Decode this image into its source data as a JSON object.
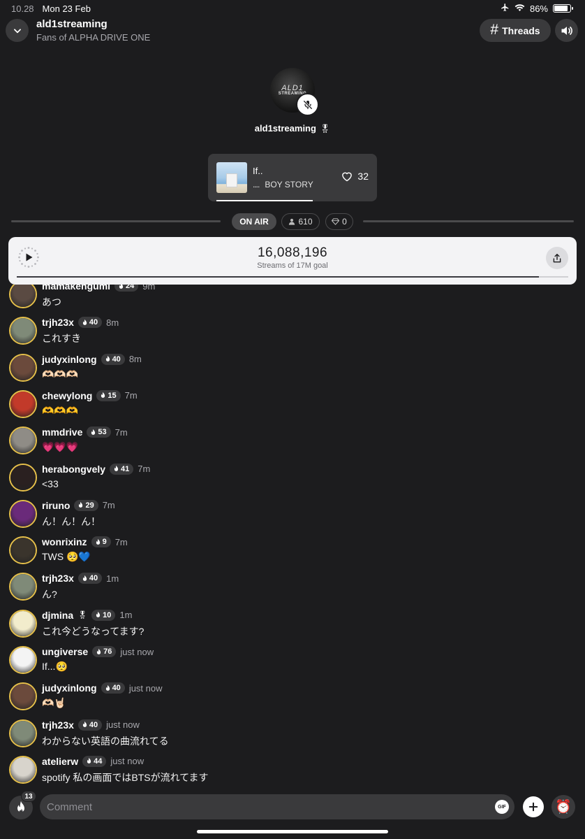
{
  "status_bar": {
    "time": "10.28",
    "date": "Mon 23 Feb",
    "battery": "86%",
    "battery_level": 0.86
  },
  "header": {
    "title": "ald1streaming",
    "subtitle": "Fans of ALPHA DRIVE ONE",
    "threads_label": "Threads"
  },
  "host": {
    "name": "ald1streaming",
    "badge": "🎖",
    "logo_top": "ALD1",
    "logo_bottom": "STREAMING"
  },
  "now_playing": {
    "title": "If..",
    "artist_prefix": "....",
    "artist": "BOY STORY",
    "likes": "32",
    "progress": 0.57
  },
  "live": {
    "on_air": "ON AIR",
    "listeners": "610",
    "gems": "0"
  },
  "goal": {
    "count": "16,088,196",
    "caption": "Streams of 17M goal",
    "progress": 0.9464
  },
  "messages": [
    {
      "user": "mamakengumi",
      "badge": "",
      "fire": "24",
      "time": "9m",
      "text": "あつ",
      "color": "#5a4a42"
    },
    {
      "user": "trjh23x",
      "badge": "",
      "fire": "40",
      "time": "8m",
      "text": "これすき",
      "color": "#7f8a78"
    },
    {
      "user": "judyxinlong",
      "badge": "",
      "fire": "40",
      "time": "8m",
      "text": "🫶🏻🫶🏻🫶🏻",
      "color": "#6b4a3c"
    },
    {
      "user": "chewylong",
      "badge": "",
      "fire": "15",
      "time": "7m",
      "text": "🫶🫶🫶",
      "color": "#c23a2a"
    },
    {
      "user": "mmdrive",
      "badge": "",
      "fire": "53",
      "time": "7m",
      "text": "💗💗💗",
      "color": "#8f8c86"
    },
    {
      "user": "herabongvely",
      "badge": "",
      "fire": "41",
      "time": "7m",
      "text": "<33",
      "color": "#2a2020"
    },
    {
      "user": "riruno",
      "badge": "",
      "fire": "29",
      "time": "7m",
      "text": "ん！ん！ん！",
      "color": "#6a2a7a"
    },
    {
      "user": "wonrixinz",
      "badge": "",
      "fire": "9",
      "time": "7m",
      "text": "TWS 🥺💙",
      "color": "#3a342c"
    },
    {
      "user": "trjh23x",
      "badge": "",
      "fire": "40",
      "time": "1m",
      "text": "ん?",
      "color": "#7f8a78"
    },
    {
      "user": "djmina",
      "badge": "🎖",
      "fire": "10",
      "time": "1m",
      "text": "これ今どうなってます?",
      "color": "#f2eccc"
    },
    {
      "user": "ungiverse",
      "badge": "",
      "fire": "76",
      "time": "just now",
      "text": "If...🥺",
      "color": "#f4f4f4"
    },
    {
      "user": "judyxinlong",
      "badge": "",
      "fire": "40",
      "time": "just now",
      "text": "🫶🏻🤘🏻",
      "color": "#6b4a3c"
    },
    {
      "user": "trjh23x",
      "badge": "",
      "fire": "40",
      "time": "just now",
      "text": "わからない英語の曲流れてる",
      "color": "#7f8a78"
    },
    {
      "user": "atelierw",
      "badge": "",
      "fire": "44",
      "time": "just now",
      "text": "spotify 私の画面ではBTSが流れてます",
      "color": "#d8d4cc"
    }
  ],
  "composer": {
    "placeholder": "Comment",
    "fire_count": "13",
    "gif_label": "GIF",
    "alarm_icon": "⏰"
  }
}
